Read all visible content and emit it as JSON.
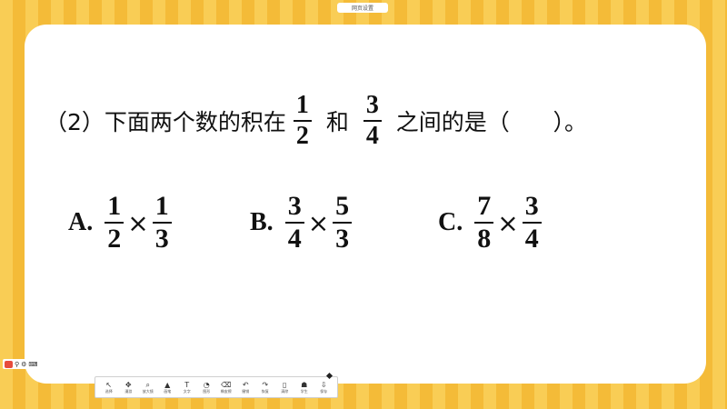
{
  "window": {
    "top_label": "网页设置"
  },
  "question": {
    "prefix": "（2）下面两个数的积在",
    "frac1": {
      "num": "1",
      "den": "2"
    },
    "mid": " 和 ",
    "frac2": {
      "num": "3",
      "den": "4"
    },
    "suffix": " 之间的是（      ）。"
  },
  "options": [
    {
      "label": "A.",
      "f1": {
        "num": "1",
        "den": "2"
      },
      "f2": {
        "num": "1",
        "den": "3"
      }
    },
    {
      "label": "B.",
      "f1": {
        "num": "3",
        "den": "4"
      },
      "f2": {
        "num": "5",
        "den": "3"
      }
    },
    {
      "label": "C.",
      "f1": {
        "num": "7",
        "den": "8"
      },
      "f2": {
        "num": "3",
        "den": "4"
      }
    }
  ],
  "times_symbol": "×",
  "toolbar": {
    "tools": [
      {
        "icon": "↖",
        "label": "选择",
        "icon_name": "pointer-icon"
      },
      {
        "icon": "✥",
        "label": "漫游",
        "icon_name": "move-icon"
      },
      {
        "icon": "⌕",
        "label": "放大镜",
        "icon_name": "magnifier-icon"
      },
      {
        "icon": "▲",
        "label": "画笔",
        "icon_name": "pen-icon"
      },
      {
        "icon": "T",
        "label": "文字",
        "icon_name": "text-icon"
      },
      {
        "icon": "◔",
        "label": "图形",
        "icon_name": "shape-icon"
      },
      {
        "icon": "⌫",
        "label": "橡皮擦",
        "icon_name": "eraser-icon"
      },
      {
        "icon": "↶",
        "label": "撤销",
        "icon_name": "undo-icon"
      },
      {
        "icon": "↷",
        "label": "恢复",
        "icon_name": "redo-icon"
      },
      {
        "icon": "▯",
        "label": "清除",
        "icon_name": "clear-icon"
      },
      {
        "icon": "☗",
        "label": "学生",
        "icon_name": "students-icon"
      },
      {
        "icon": "⇩",
        "label": "保存",
        "icon_name": "save-icon"
      }
    ]
  }
}
